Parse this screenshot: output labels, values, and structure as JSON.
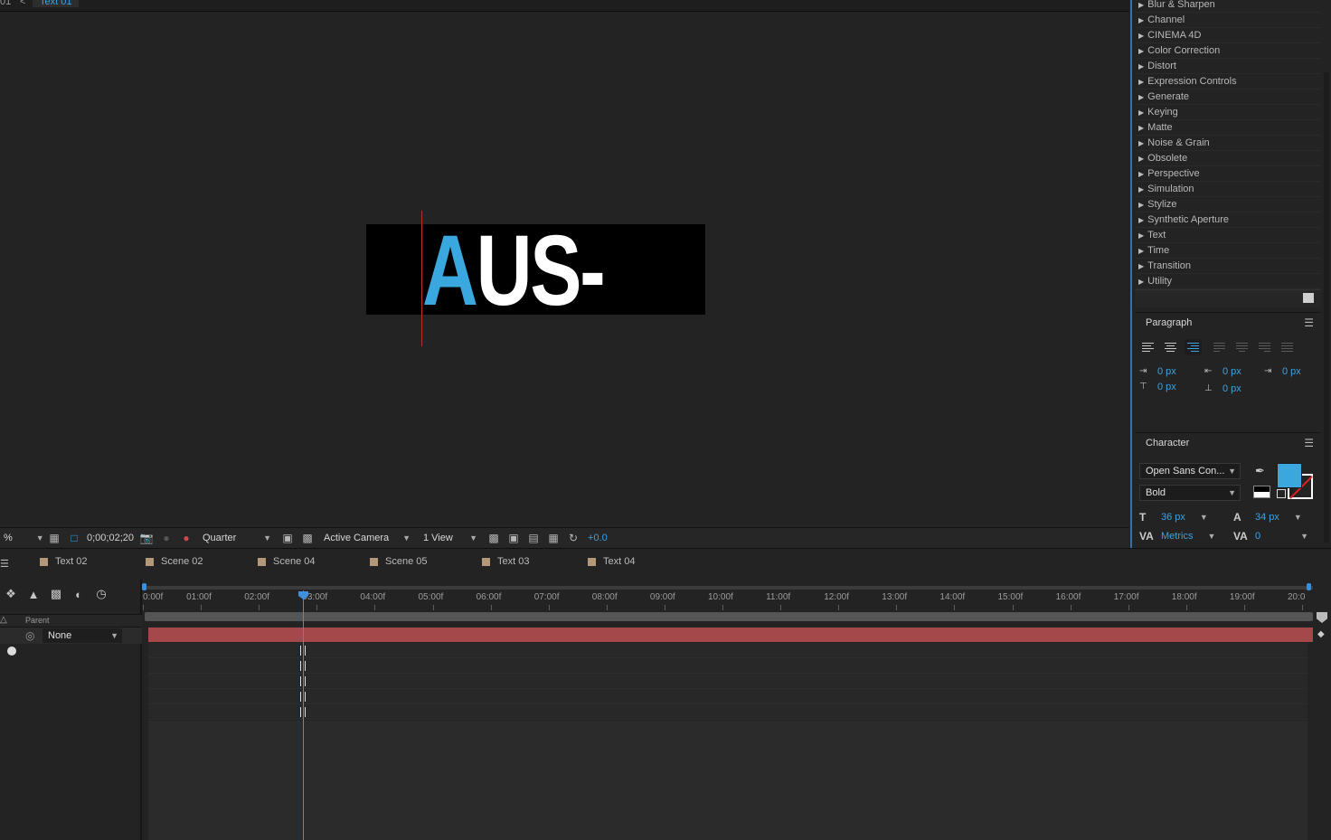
{
  "viewer": {
    "tab_prev": "01",
    "tab_sep": "<",
    "tab_current": "Text 01",
    "canvas_first_letter": "A",
    "canvas_rest": "US-",
    "toolbar": {
      "zoom": "%",
      "timecode": "0;00;02;20",
      "resolution": "Quarter",
      "camera": "Active Camera",
      "views": "1 View",
      "exposure": "+0.0"
    }
  },
  "effects": {
    "items": [
      "Blur & Sharpen",
      "Channel",
      "CINEMA 4D",
      "Color Correction",
      "Distort",
      "Expression Controls",
      "Generate",
      "Keying",
      "Matte",
      "Noise & Grain",
      "Obsolete",
      "Perspective",
      "Simulation",
      "Stylize",
      "Synthetic Aperture",
      "Text",
      "Time",
      "Transition",
      "Utility"
    ]
  },
  "paragraph": {
    "title": "Paragraph",
    "indent_left": "0 px",
    "indent_right": "0 px",
    "indent_first": "0 px",
    "space_before": "0 px",
    "space_after": "0 px"
  },
  "character": {
    "title": "Character",
    "font_family": "Open Sans Con...",
    "font_style": "Bold",
    "font_size": "36 px",
    "leading": "34 px",
    "kerning": "Metrics",
    "tracking": "0",
    "fill_color": "#3aa8de"
  },
  "timeline": {
    "tabs": [
      "Text 02",
      "Scene 02",
      "Scene 04",
      "Scene 05",
      "Text 03",
      "Text 04"
    ],
    "parent_header": "Parent",
    "parent_value": "None",
    "ruler": [
      "0:00f",
      "01:00f",
      "02:00f",
      "03:00f",
      "04:00f",
      "05:00f",
      "06:00f",
      "07:00f",
      "08:00f",
      "09:00f",
      "10:00f",
      "11:00f",
      "12:00f",
      "13:00f",
      "14:00f",
      "15:00f",
      "16:00f",
      "17:00f",
      "18:00f",
      "19:00f",
      "20:0"
    ],
    "layer_color": "#a5484c",
    "playhead_accent": "#3f8fdc"
  }
}
